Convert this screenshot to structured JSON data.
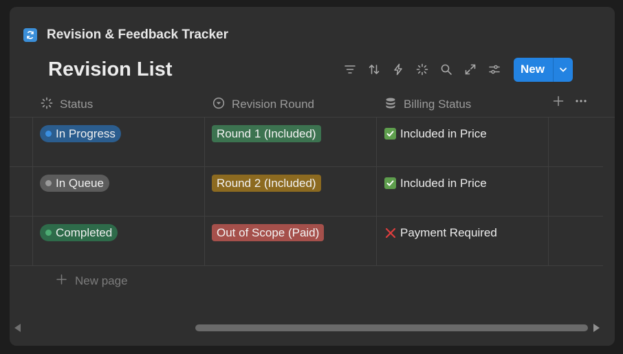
{
  "database": {
    "title": "Revision & Feedback Tracker",
    "icon": "sync-icon"
  },
  "view": {
    "title": "Revision List"
  },
  "toolbar": {
    "icons": [
      "filter-icon",
      "sort-icon",
      "automation-icon",
      "ai-sparkle-icon",
      "search-icon",
      "expand-icon",
      "settings-icon"
    ],
    "new_label": "New"
  },
  "columns": [
    {
      "label": "Status",
      "icon": "status-icon"
    },
    {
      "label": "Revision Round",
      "icon": "select-icon"
    },
    {
      "label": "Billing Status",
      "icon": "database-icon"
    }
  ],
  "rows": [
    {
      "status": {
        "label": "In Progress",
        "bg": "#2b5d8e",
        "dot": "#3b8fe0"
      },
      "round": {
        "label": "Round 1 (Included)",
        "bg": "#3c7350"
      },
      "billing": {
        "label": "Included in Price",
        "icon": "check-icon"
      }
    },
    {
      "status": {
        "label": "In Queue",
        "bg": "#5c5c5c",
        "dot": "#9a9a9a"
      },
      "round": {
        "label": "Round 2 (Included)",
        "bg": "#8c6a20"
      },
      "billing": {
        "label": "Included in Price",
        "icon": "check-icon"
      }
    },
    {
      "status": {
        "label": "Completed",
        "bg": "#2e6b4a",
        "dot": "#4dab73"
      },
      "round": {
        "label": "Out of Scope (Paid)",
        "bg": "#a5504b"
      },
      "billing": {
        "label": "Payment Required",
        "icon": "cross-icon"
      }
    }
  ],
  "new_page_label": "New page",
  "colors": {
    "accent": "#2383e2",
    "background": "#2f2f2f",
    "cross": "#e03e3e",
    "check": "#5e9e4d"
  }
}
